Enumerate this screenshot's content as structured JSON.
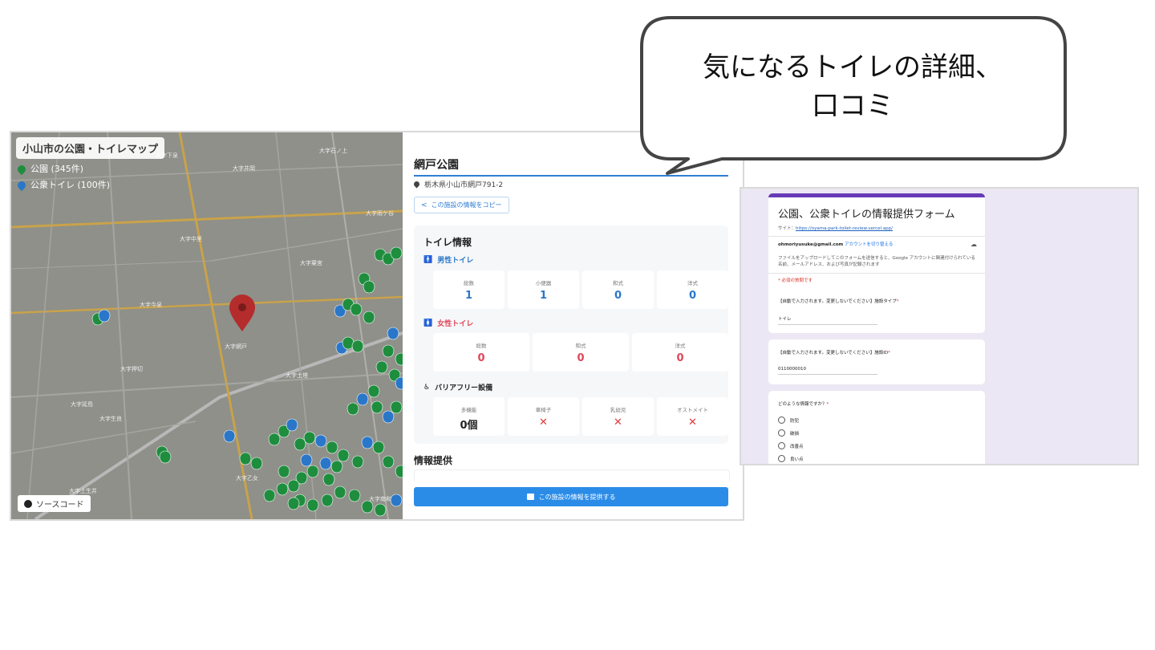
{
  "callout": {
    "line1": "気になるトイレの詳細、",
    "line2": "口コミ"
  },
  "map": {
    "title": "小山市の公園・トイレマップ",
    "legend": [
      {
        "label": "公園 (345件)",
        "color": "#1e8e3e"
      },
      {
        "label": "公衆トイレ (100件)",
        "color": "#2a77c9"
      }
    ],
    "source_button": "ソースコード",
    "selected_pin_color": "#b52c2c",
    "place_labels": [
      "大字石ノ上",
      "大字下泉",
      "大字井岡",
      "大字中里",
      "大字雨ケ谷",
      "大字網戸",
      "大字今泉",
      "大字生良",
      "大字乙女",
      "大字上生井",
      "大字延島",
      "大字粟宮",
      "大字押切",
      "大字土塔",
      "大字南和泉"
    ]
  },
  "detail": {
    "name": "網戸公園",
    "address": "栃木県小山市網戸791-2",
    "copy_button": "この施設の情報をコピー",
    "toilet_section_title": "トイレ情報",
    "male": {
      "title": "男性トイレ",
      "stats": [
        {
          "label": "総数",
          "value": "1"
        },
        {
          "label": "小便器",
          "value": "1"
        },
        {
          "label": "和式",
          "value": "0"
        },
        {
          "label": "洋式",
          "value": "0"
        }
      ]
    },
    "female": {
      "title": "女性トイレ",
      "stats": [
        {
          "label": "総数",
          "value": "0"
        },
        {
          "label": "和式",
          "value": "0"
        },
        {
          "label": "洋式",
          "value": "0"
        }
      ]
    },
    "barrier_free": {
      "title": "バリアフリー設備",
      "stats": [
        {
          "label": "多機能",
          "value": "0個"
        },
        {
          "label": "車椅子",
          "value": "✕"
        },
        {
          "label": "乳幼児",
          "value": "✕"
        },
        {
          "label": "オストメイト",
          "value": "✕"
        }
      ]
    },
    "provide_title": "情報提供",
    "provide_button": "この施設の情報を提供する"
  },
  "form": {
    "title": "公園、公衆トイレの情報提供フォーム",
    "site_label": "サイト：",
    "site_url": "https://oyama-park-toilet-review.vercel.app/",
    "account_email": "ohmoriyusuke@gmail.com",
    "switch_account": "アカウントを切り替える",
    "upload_note": "ファイルをアップロードしてこのフォームを送信すると、Google アカウントに関連付けられている名前、メールアドレス、および写真が記録されます",
    "required_note": "* 必須の質問です",
    "q1": {
      "title": "【自動で入力されます。変更しないでください】施設タイプ",
      "answer": "トイレ"
    },
    "q2": {
      "title": "【自動で入力されます。変更しないでください】施設ID",
      "answer": "0110000010"
    },
    "q3": {
      "title": "どのような情報ですか？",
      "options": [
        "防犯",
        "破損",
        "改善点",
        "良い点"
      ]
    },
    "required_mark": "*"
  }
}
